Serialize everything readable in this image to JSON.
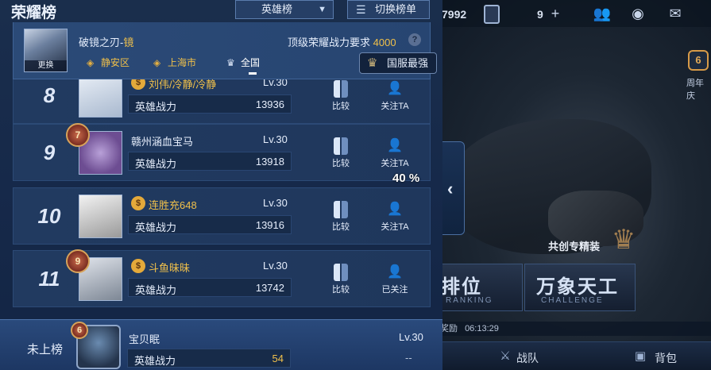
{
  "panel": {
    "title": "荣耀榜",
    "hero_select": "英雄榜",
    "switch_list": "切换榜单"
  },
  "hero_card": {
    "hero_name": "破镜之刃-",
    "hero_alt": "镜",
    "swap_label": "更换",
    "requirement_label": "顶级荣耀战力要求",
    "requirement_value": "4000",
    "regions": [
      "静安区",
      "上海市",
      "全国"
    ],
    "national_button": "国服最强"
  },
  "rows": [
    {
      "rank": "8",
      "name": "刘伟/冷静/冷静",
      "level": "Lv.30",
      "power_label": "英雄战力",
      "power": "13936",
      "compare": "比较",
      "follow": "关注TA"
    },
    {
      "rank": "9",
      "badge": "7",
      "name": "赣州涵血宝马",
      "level": "Lv.30",
      "power_label": "英雄战力",
      "power": "13918",
      "compare": "比较",
      "follow": "关注TA"
    },
    {
      "rank": "10",
      "name": "连胜充648",
      "level": "Lv.30",
      "power_label": "英雄战力",
      "power": "13916",
      "compare": "比较",
      "follow": "关注TA"
    },
    {
      "rank": "11",
      "badge": "9",
      "name": "斗鱼昧昧",
      "level": "Lv.30",
      "power_label": "英雄战力",
      "power": "13742",
      "compare": "比较",
      "follow": "已关注"
    }
  ],
  "self": {
    "rank_label": "未上榜",
    "badge": "6",
    "name": "宝贝眠",
    "level": "Lv.30",
    "power_label": "英雄战力",
    "power": "54",
    "dash": "--"
  },
  "overlay": {
    "percent": "40 %"
  },
  "background": {
    "top_number": "7992",
    "friend_count": "9",
    "year_label": "周年庆",
    "equip_label": "共创专精装",
    "mode_ranked": "排位",
    "mode_ranked_en": "RANKING",
    "mode_challenge": "万象天工",
    "mode_challenge_en": "CHALLENGE",
    "reward_label": "奖励",
    "reward_timer": "06:13:29",
    "nav_team": "战队",
    "nav_bag": "背包"
  },
  "colors": {
    "accent_gold": "#f0c04a",
    "panel_bg": "#1a2e4c"
  }
}
